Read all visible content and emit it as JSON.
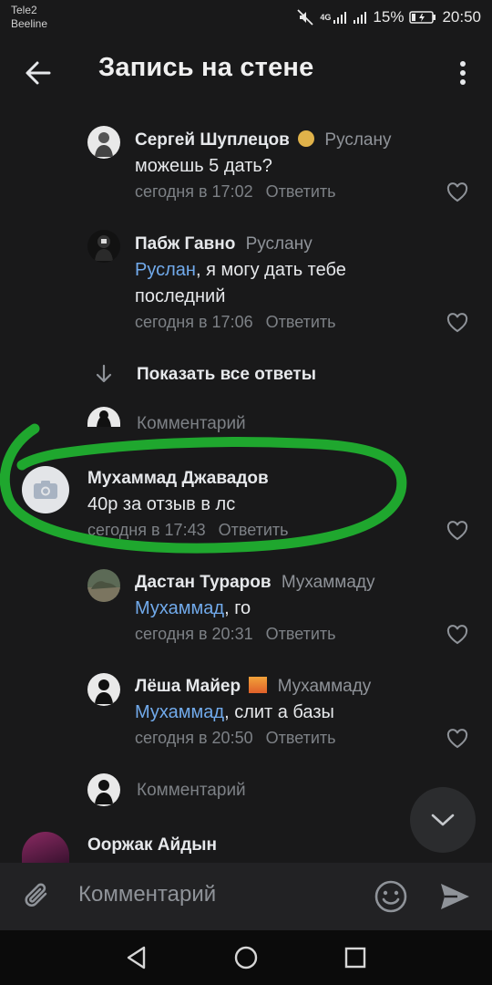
{
  "status_bar": {
    "carrier_1": "Tele2",
    "carrier_2": "Beeline",
    "network": "4G",
    "battery": "15%",
    "time": "20:50"
  },
  "header": {
    "title": "Запись на стене"
  },
  "comments": [
    {
      "author": "Сергей Шуплецов",
      "reply_to": "Руслану",
      "text_mention": "",
      "text": "можешь 5 дать?",
      "time": "сегодня в 17:02",
      "reply_label": "Ответить"
    },
    {
      "author": "Пабж Гавно",
      "reply_to": "Руслану",
      "text_mention": "Руслан",
      "text": ", я могу дать тебе последний",
      "time": "сегодня в 17:06",
      "reply_label": "Ответить"
    },
    {
      "author": "Мухаммад Джавадов",
      "reply_to": "",
      "text_mention": "",
      "text": "40р за отзыв в лс",
      "time": "сегодня в 17:43",
      "reply_label": "Ответить"
    },
    {
      "author": "Дастан Тураров",
      "reply_to": "Мухаммаду",
      "text_mention": "Мухаммад",
      "text": ", го",
      "time": "сегодня в 20:31",
      "reply_label": "Ответить"
    },
    {
      "author": "Лёша Майер",
      "reply_to": "Мухаммаду",
      "text_mention": "Мухаммад",
      "text": ", слит а базы",
      "time": "сегодня в 20:50",
      "reply_label": "Ответить"
    },
    {
      "author": "Ооржак Айдын"
    }
  ],
  "show_all_replies": "Показать все ответы",
  "comment_placeholder": "Комментарий",
  "composer": {
    "placeholder": "Комментарий"
  },
  "colors": {
    "background": "#19191a",
    "mention": "#71aaeb",
    "highlight": "#1fa72e"
  }
}
